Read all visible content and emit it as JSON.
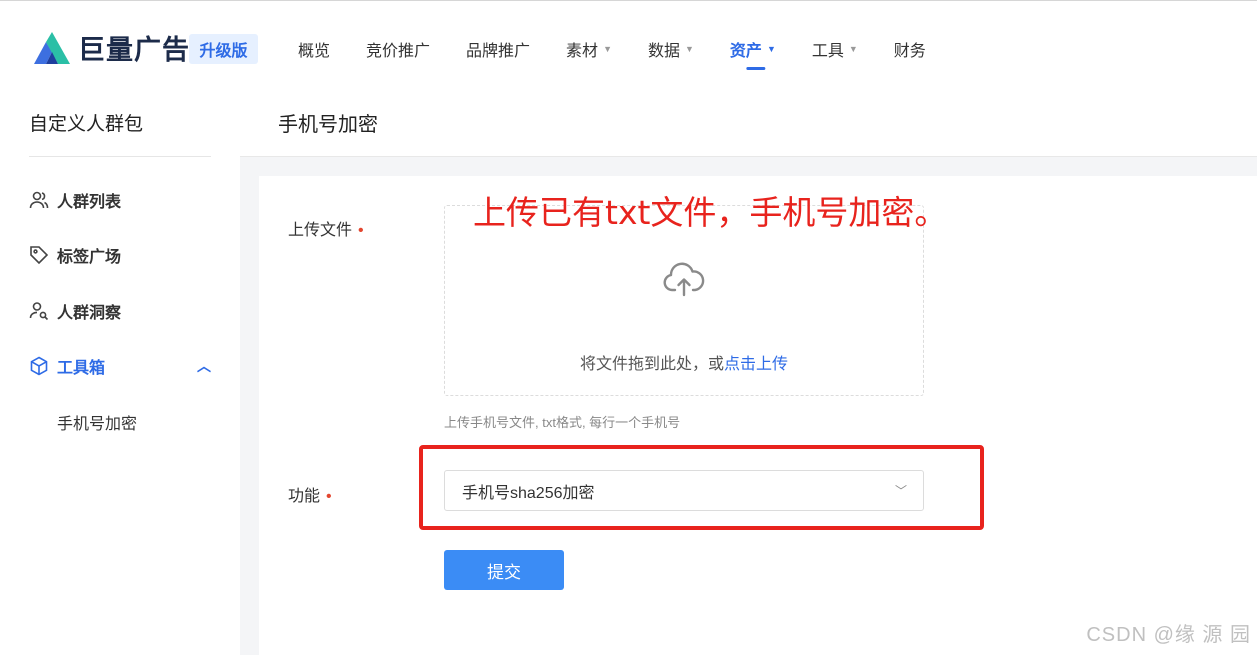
{
  "brand": {
    "name": "巨量广告",
    "badge": "升级版"
  },
  "nav": [
    {
      "label": "概览",
      "dropdown": false,
      "active": false
    },
    {
      "label": "竞价推广",
      "dropdown": false,
      "active": false
    },
    {
      "label": "品牌推广",
      "dropdown": false,
      "active": false
    },
    {
      "label": "素材",
      "dropdown": true,
      "active": false
    },
    {
      "label": "数据",
      "dropdown": true,
      "active": false
    },
    {
      "label": "资产",
      "dropdown": true,
      "active": true
    },
    {
      "label": "工具",
      "dropdown": true,
      "active": false
    },
    {
      "label": "财务",
      "dropdown": false,
      "active": false
    }
  ],
  "sidebar": {
    "title": "自定义人群包",
    "items": [
      {
        "label": "人群列表",
        "icon": "users-icon"
      },
      {
        "label": "标签广场",
        "icon": "tag-icon"
      },
      {
        "label": "人群洞察",
        "icon": "user-search-icon"
      },
      {
        "label": "工具箱",
        "icon": "cube-icon",
        "expanded": true
      }
    ],
    "sub_item": "手机号加密"
  },
  "page": {
    "title": "手机号加密"
  },
  "form": {
    "upload_label": "上传文件",
    "upload_text": "将文件拖到此处，或",
    "upload_link": "点击上传",
    "upload_hint": "上传手机号文件, txt格式, 每行一个手机号",
    "function_label": "功能",
    "function_value": "手机号sha256加密",
    "submit_label": "提交",
    "required_mark": "•"
  },
  "annotation": "上传已有txt文件，手机号加密。",
  "watermark": "CSDN @缘 源 园",
  "colors": {
    "accent": "#2e6be6",
    "submit": "#3b8cf5",
    "annotation": "#e8231d"
  }
}
